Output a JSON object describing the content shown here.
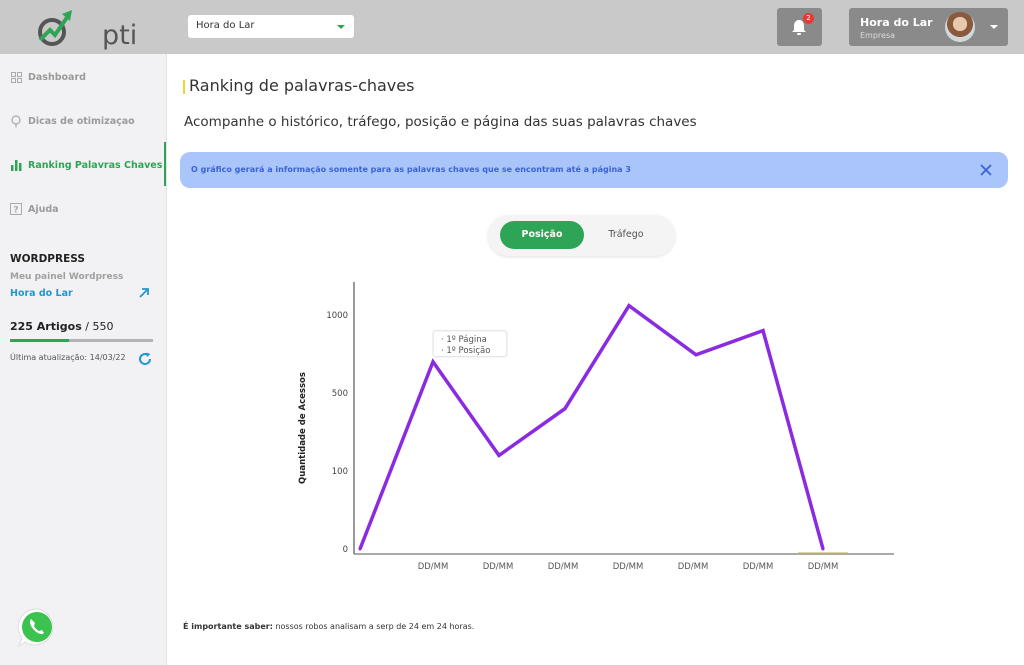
{
  "header": {
    "logo_text": "pti",
    "company_select": {
      "value": "Hora do Lar"
    },
    "notifications": {
      "count": "2"
    },
    "user": {
      "name": "Hora do Lar",
      "role": "Empresa"
    }
  },
  "sidebar": {
    "items": [
      {
        "label": "Dashboard",
        "icon": "dashboard-icon",
        "active": false
      },
      {
        "label": "Dicas de otimizaçao",
        "icon": "lightbulb-icon",
        "active": false
      },
      {
        "label": "Ranking Palavras Chaves",
        "icon": "bar-chart-icon",
        "active": true
      },
      {
        "label": "Ajuda",
        "icon": "help-icon",
        "active": false
      }
    ],
    "wordpress": {
      "title": "WORDPRESS",
      "subtitle": "Meu painel Wordpress",
      "site_link": "Hora do Lar",
      "articles_done": "225 Artigos",
      "articles_total": " / 550",
      "progress_fraction": 0.41,
      "last_update": "Última atualização: 14/03/22"
    }
  },
  "main": {
    "title": "Ranking de palavras-chaves",
    "subtitle": "Acompanhe o histórico, tráfego, posição e página das suas palavras chaves",
    "alert": "O gráfico gerará a informação somente para as palavras chaves que se encontram até a página 3",
    "toggle": {
      "active": "Posição",
      "inactive": "Tráfego"
    },
    "footnote_bold": "É importante saber:",
    "footnote_text": " nossos robos analisam a serp de 24 em 24 horas."
  },
  "colors": {
    "accent": "#2ea556",
    "line": "#8a2be2",
    "alert_bg": "#a9c5f9",
    "alert_text": "#3c63d6"
  },
  "chart_data": {
    "type": "line",
    "title": "",
    "xlabel": "",
    "ylabel": "Quantidade de Acessos",
    "y_ticks": [
      0,
      100,
      500,
      1000
    ],
    "y_scale": "piecewise (ticks equally spaced)",
    "categories": [
      "",
      "DD/MM",
      "DD/MM",
      "DD/MM",
      "DD/MM",
      "DD/MM",
      "DD/MM",
      "DD/MM"
    ],
    "x_tick_labels": [
      "DD/MM",
      "DD/MM",
      "DD/MM",
      "DD/MM",
      "DD/MM",
      "DD/MM",
      "DD/MM"
    ],
    "series": [
      {
        "name": "Acessos",
        "values": [
          0,
          700,
          180,
          420,
          1060,
          745,
          900,
          0
        ]
      }
    ],
    "tooltip": {
      "point_index": 1,
      "lines": [
        "1º Página",
        "1º Posição"
      ]
    },
    "grid": false,
    "legend": "none"
  }
}
